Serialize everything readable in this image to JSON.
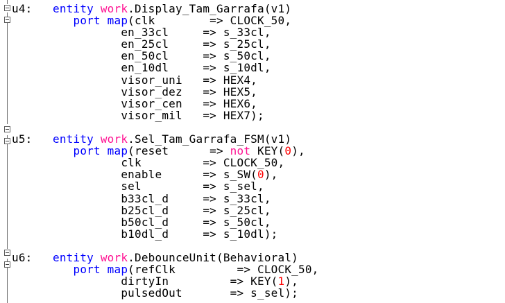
{
  "editor": {
    "colors": {
      "background": "#ffffff",
      "text": "#000000",
      "keyword": "#0000ff",
      "library": "#ff1493",
      "number": "#ff0000",
      "gutter": "#6b6b6b"
    },
    "icons": {
      "fold": "fold-minus-icon"
    },
    "blocks": [
      {
        "id": "u4",
        "lines": [
          [
            {
              "t": "u4:   ",
              "c": ""
            },
            {
              "t": "entity",
              "c": "kw"
            },
            {
              "t": " ",
              "c": ""
            },
            {
              "t": "work",
              "c": "lib"
            },
            {
              "t": ".Display_Tam_Garrafa(v1)",
              "c": ""
            }
          ],
          [
            {
              "t": "         ",
              "c": ""
            },
            {
              "t": "port map",
              "c": "kw"
            },
            {
              "t": "(clk        => CLOCK_50,",
              "c": ""
            }
          ],
          [
            {
              "t": "                en_33cl     => s_33cl,",
              "c": ""
            }
          ],
          [
            {
              "t": "                en_25cl     => s_25cl,",
              "c": ""
            }
          ],
          [
            {
              "t": "                en_50cl     => s_50cl,",
              "c": ""
            }
          ],
          [
            {
              "t": "                en_10dl     => s_10dl,",
              "c": ""
            }
          ],
          [
            {
              "t": "                visor_uni   => HEX4,",
              "c": ""
            }
          ],
          [
            {
              "t": "                visor_dez   => HEX5,",
              "c": ""
            }
          ],
          [
            {
              "t": "                visor_cen   => HEX6,",
              "c": ""
            }
          ],
          [
            {
              "t": "                visor_mil   => HEX7);",
              "c": ""
            }
          ]
        ]
      },
      {
        "id": "blank1",
        "lines": [
          [
            {
              "t": "",
              "c": ""
            }
          ]
        ]
      },
      {
        "id": "u5",
        "lines": [
          [
            {
              "t": "u5:   ",
              "c": ""
            },
            {
              "t": "entity",
              "c": "kw"
            },
            {
              "t": " ",
              "c": ""
            },
            {
              "t": "work",
              "c": "lib"
            },
            {
              "t": ".Sel_Tam_Garrafa_FSM(v1)",
              "c": ""
            }
          ],
          [
            {
              "t": "         ",
              "c": ""
            },
            {
              "t": "port map",
              "c": "kw"
            },
            {
              "t": "(reset      => ",
              "c": ""
            },
            {
              "t": "not",
              "c": "lib"
            },
            {
              "t": " KEY(",
              "c": ""
            },
            {
              "t": "0",
              "c": "num"
            },
            {
              "t": "),",
              "c": ""
            }
          ],
          [
            {
              "t": "                clk         => CLOCK_50,",
              "c": ""
            }
          ],
          [
            {
              "t": "                enable      => s_SW(",
              "c": ""
            },
            {
              "t": "0",
              "c": "num"
            },
            {
              "t": "),",
              "c": ""
            }
          ],
          [
            {
              "t": "                sel         => s_sel,",
              "c": ""
            }
          ],
          [
            {
              "t": "                b33cl_d     => s_33cl,",
              "c": ""
            }
          ],
          [
            {
              "t": "                b25cl_d     => s_25cl,",
              "c": ""
            }
          ],
          [
            {
              "t": "                b50cl_d     => s_50cl,",
              "c": ""
            }
          ],
          [
            {
              "t": "                b10dl_d     => s_10dl);",
              "c": ""
            }
          ]
        ]
      },
      {
        "id": "blank2",
        "lines": [
          [
            {
              "t": "",
              "c": ""
            }
          ]
        ]
      },
      {
        "id": "u6",
        "lines": [
          [
            {
              "t": "u6:   ",
              "c": ""
            },
            {
              "t": "entity",
              "c": "kw"
            },
            {
              "t": " ",
              "c": ""
            },
            {
              "t": "work",
              "c": "lib"
            },
            {
              "t": ".DebounceUnit(Behavioral)",
              "c": ""
            }
          ],
          [
            {
              "t": "         ",
              "c": ""
            },
            {
              "t": "port map",
              "c": "kw"
            },
            {
              "t": "(refClk         => CLOCK_50,",
              "c": ""
            }
          ],
          [
            {
              "t": "                dirtyIn         => KEY(",
              "c": ""
            },
            {
              "t": "1",
              "c": "num"
            },
            {
              "t": "),",
              "c": ""
            }
          ],
          [
            {
              "t": "                pulsedOut       => s_sel);",
              "c": ""
            }
          ]
        ]
      }
    ]
  }
}
